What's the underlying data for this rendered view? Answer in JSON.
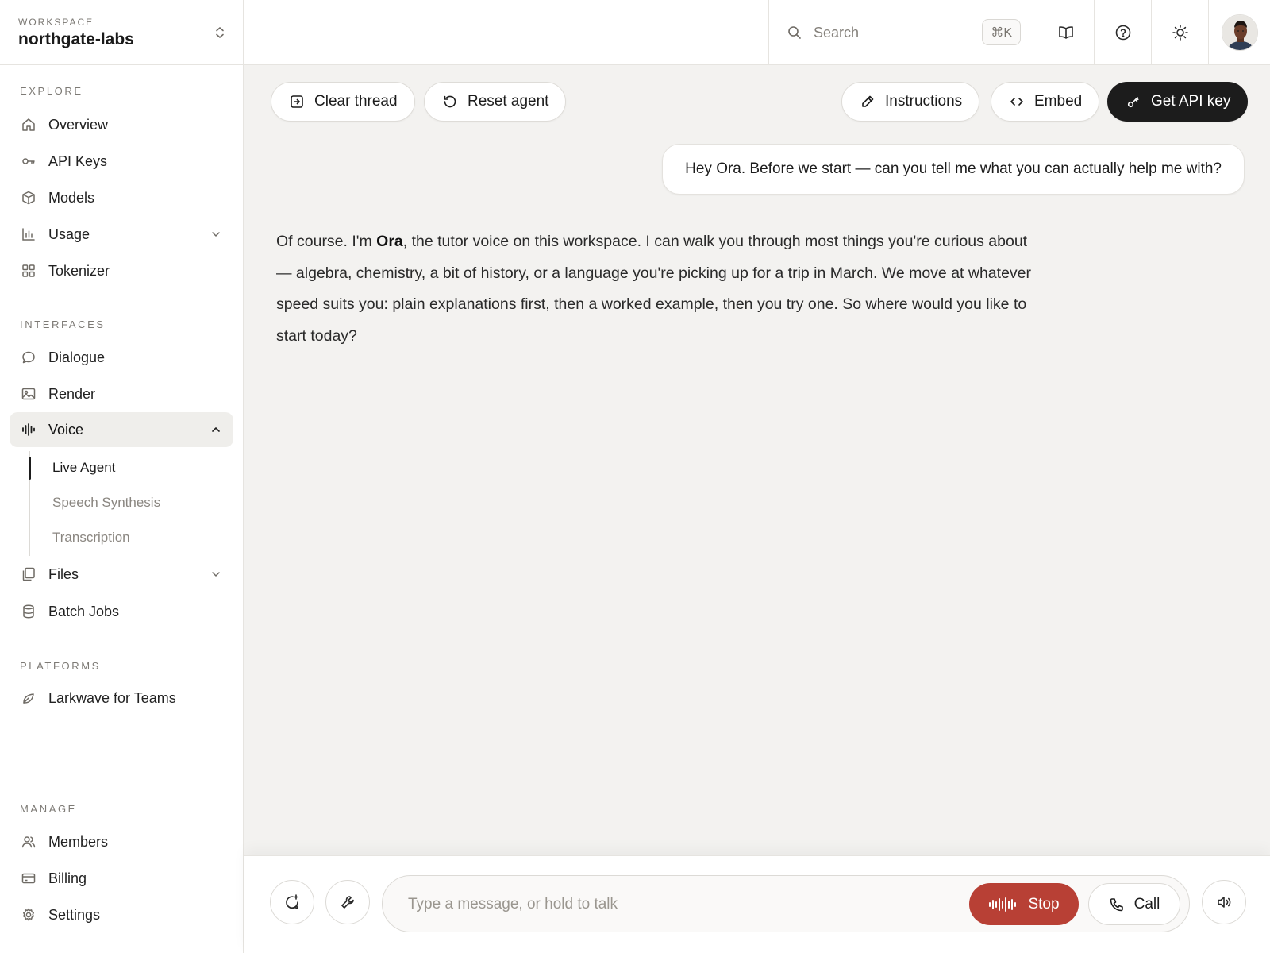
{
  "workspace": {
    "label": "WORKSPACE",
    "name": "northgate-labs"
  },
  "sidebar": {
    "sections": {
      "explore": "EXPLORE",
      "interfaces": "INTERFACES",
      "platforms": "PLATFORMS",
      "manage": "MANAGE"
    },
    "explore_items": [
      {
        "label": "Overview",
        "icon": "home-icon"
      },
      {
        "label": "API Keys",
        "icon": "key-icon"
      },
      {
        "label": "Models",
        "icon": "cube-icon"
      },
      {
        "label": "Usage",
        "icon": "bar-chart-icon",
        "expandable": true
      },
      {
        "label": "Tokenizer",
        "icon": "grid-icon"
      }
    ],
    "interface_items": [
      {
        "label": "Dialogue",
        "icon": "chat-bubble-icon"
      },
      {
        "label": "Render",
        "icon": "image-icon"
      },
      {
        "label": "Voice",
        "icon": "waveform-icon",
        "expanded": true,
        "active": true
      },
      {
        "label": "Files",
        "icon": "files-icon",
        "expandable": true
      },
      {
        "label": "Batch Jobs",
        "icon": "database-icon"
      }
    ],
    "voice_sub_items": [
      {
        "label": "Live Agent",
        "active": true
      },
      {
        "label": "Speech Synthesis"
      },
      {
        "label": "Transcription"
      }
    ],
    "platform_items": [
      {
        "label": "Larkwave for Teams",
        "icon": "leaf-icon"
      }
    ],
    "manage_items": [
      {
        "label": "Members",
        "icon": "users-icon"
      },
      {
        "label": "Billing",
        "icon": "credit-card-icon"
      },
      {
        "label": "Settings",
        "icon": "gear-icon"
      }
    ]
  },
  "topbar": {
    "search_placeholder": "Search",
    "search_shortcut": "⌘K",
    "buttons": [
      "docs-book-icon",
      "help-icon",
      "theme-sun-icon",
      "avatar"
    ]
  },
  "actions": {
    "clear_thread": "Clear thread",
    "reset_agent": "Reset agent",
    "instructions": "Instructions",
    "embed": "Embed",
    "get_api_key": "Get API key"
  },
  "thread": {
    "user_message": "Hey Ora. Before we start — can you tell me what you can actually help me with?",
    "agent_message": {
      "prefix": "Of course. I'm ",
      "name": "Ora",
      "suffix": ", the tutor voice on this workspace. I can walk you through most things you're curious about — algebra, chemistry, a bit of history, or a language you're picking up for a trip in March. We move at whatever speed suits you: plain explanations first, then a worked example, then you try one. So where would you like to start today?"
    }
  },
  "composer": {
    "placeholder": "Type a message, or hold to talk",
    "stop_label": "Stop",
    "call_label": "Call"
  },
  "colors": {
    "stop_red": "#b84035",
    "dark_button": "#1c1c1c",
    "canvas": "#f3f2f0"
  }
}
